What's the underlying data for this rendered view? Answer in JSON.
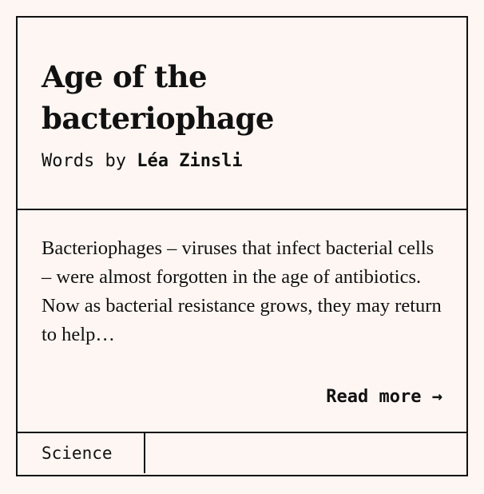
{
  "article": {
    "title": "Age of the bacteriophage",
    "byline_prefix": "Words by",
    "author": "Léa Zinsli",
    "excerpt": "Bacteriophages – viruses that infect bacterial cells – were almost forgotten in the age of antibiotics. Now as bacterial resistance grows, they may return to help…",
    "read_more_label": "Read more",
    "read_more_icon": "arrow-right-icon",
    "category": "Science"
  },
  "colors": {
    "background": "#fdf6f2",
    "text": "#111111",
    "border": "#111111"
  }
}
